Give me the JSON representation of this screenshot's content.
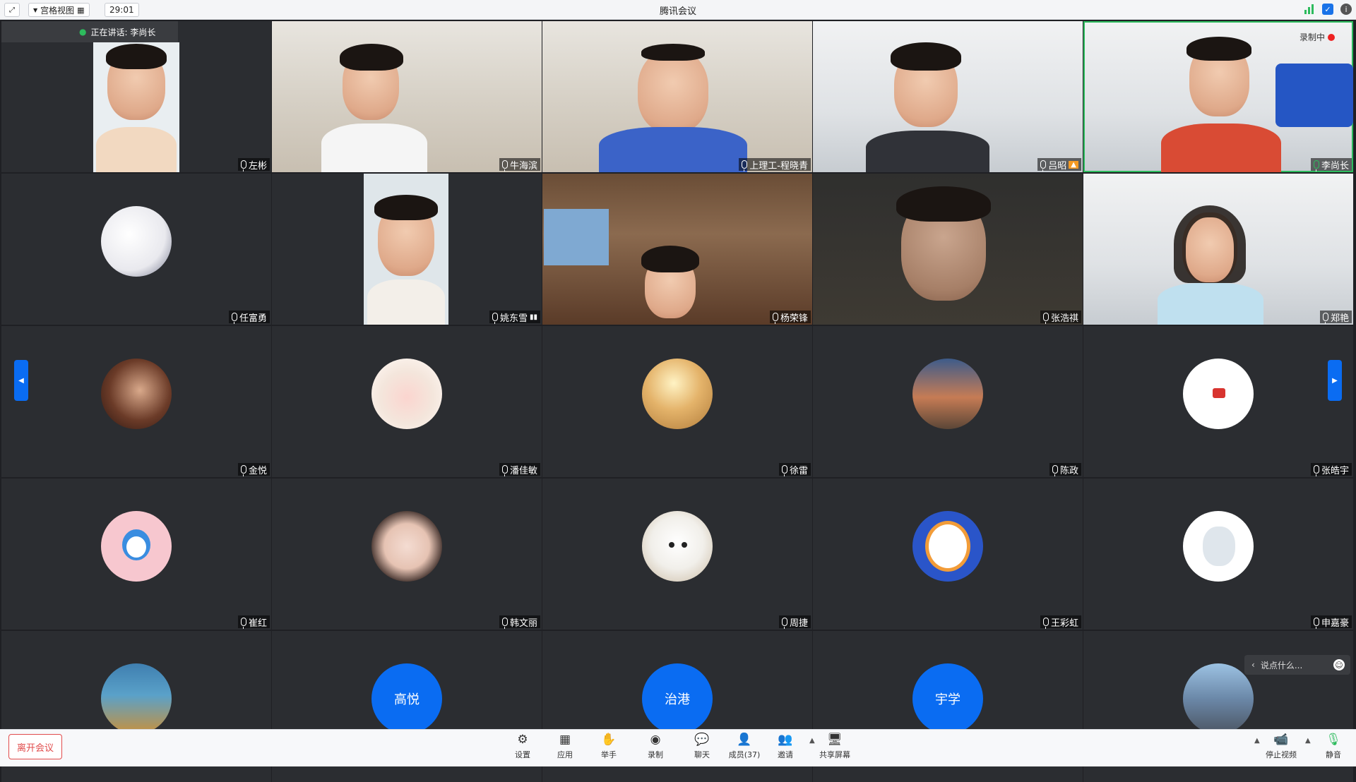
{
  "window": {
    "title": "腾讯会议"
  },
  "topbar": {
    "layout_label": "宫格视图",
    "timer": "29:01"
  },
  "speaking": {
    "label": "正在讲话: 李尚长"
  },
  "recording": {
    "label": "录制中"
  },
  "tiles": [
    {
      "name": "左彬"
    },
    {
      "name": "牛海滨"
    },
    {
      "name": "上理工-程晓青"
    },
    {
      "name": "吕昭"
    },
    {
      "name": "李尚长"
    },
    {
      "name": "任富勇"
    },
    {
      "name": "姚东雪"
    },
    {
      "name": "杨荣锋"
    },
    {
      "name": "张浩祺"
    },
    {
      "name": "郑艳"
    },
    {
      "name": "金悦"
    },
    {
      "name": "潘佳敏"
    },
    {
      "name": "徐雷"
    },
    {
      "name": "陈政"
    },
    {
      "name": "张皓宇"
    },
    {
      "name": "崔红"
    },
    {
      "name": "韩文丽"
    },
    {
      "name": "周捷"
    },
    {
      "name": "王彩虹"
    },
    {
      "name": "申嘉豪"
    },
    {
      "name": ""
    },
    {
      "name": "",
      "avatar_text": "高悦"
    },
    {
      "name": "",
      "avatar_text": "治港"
    },
    {
      "name": "",
      "avatar_text": "宇学"
    },
    {
      "name": ""
    }
  ],
  "chat_bubble": {
    "placeholder": "说点什么..."
  },
  "toolbar": {
    "leave": "离开会议",
    "mute": "静音",
    "stop_video": "停止视频",
    "share": "共享屏幕",
    "invite": "邀请",
    "members": "成员(37)",
    "chat": "聊天",
    "record": "录制",
    "raise_hand": "举手",
    "apps": "应用",
    "settings": "设置"
  },
  "colors": {
    "active_border": "#2dbb5d",
    "accent": "#0a6cf2",
    "leave": "#e14b4b"
  }
}
